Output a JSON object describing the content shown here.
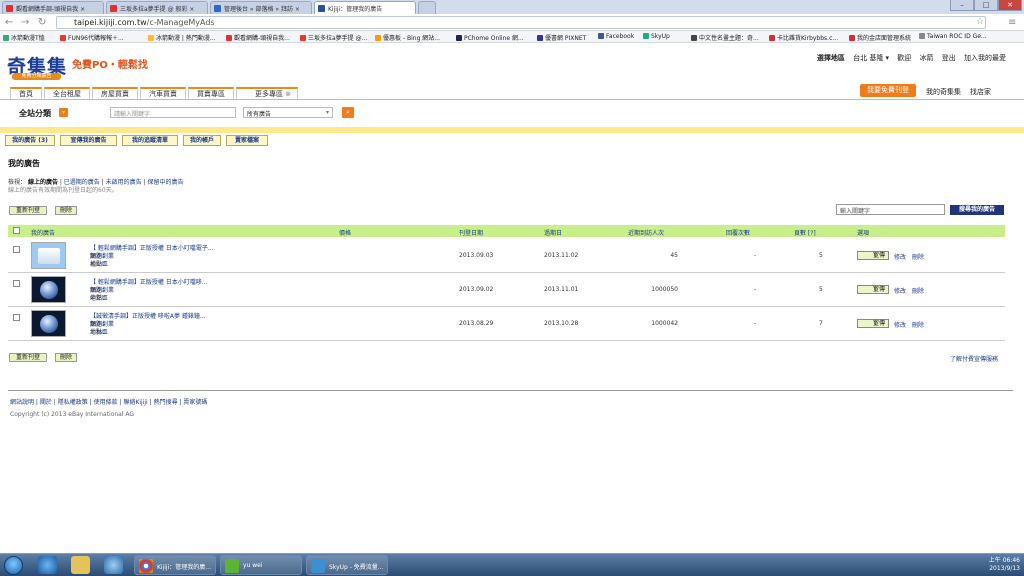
{
  "browser": {
    "tabs": [
      {
        "label": "觀看網購手調-頭視自我 ×"
      },
      {
        "label": "三坂多拉a夢手提 @ 般彩 ×"
      },
      {
        "label": "管理後台 » 部落格 » 拜訪 ×"
      },
      {
        "label": "Kijiji：管理我的廣告"
      }
    ],
    "url_host": "taipei.kijiji.com.tw",
    "url_path": "/c-ManageMyAds",
    "bookmarks": [
      {
        "label": "冰箭動漫T恤",
        "color": "#3a7"
      },
      {
        "label": "FUN96代購報報＋...",
        "color": "#e33"
      },
      {
        "label": "冰箭動漫 | 熱門動漫...",
        "color": "#fb3"
      },
      {
        "label": "觀看網購-頭視自我...",
        "color": "#d33"
      },
      {
        "label": "三坂多拉a夢手提 @...",
        "color": "#e33"
      },
      {
        "label": "優惠板 - Bing 網站...",
        "color": "#f90"
      },
      {
        "label": "PChome Online 網...",
        "color": "#225"
      },
      {
        "label": "優書網 PIXNET",
        "color": "#339"
      },
      {
        "label": "Facebook",
        "color": "#3b5998"
      },
      {
        "label": "SkyUp",
        "color": "#2a8"
      },
      {
        "label": "中文性名畫主題：奇...",
        "color": "#444"
      },
      {
        "label": "卡比雜貨Kirbybbs.c...",
        "color": "#c33"
      },
      {
        "label": "我的金店面管理系統",
        "color": "#c33"
      },
      {
        "label": "Taiwan ROC ID Ge...",
        "color": "#888"
      }
    ]
  },
  "site": {
    "logo": "奇集集",
    "sublogo": "免費分類廣告",
    "slogan": "免費PO・輕鬆找",
    "region_label": "選擇地區",
    "region_value": "台北 基隆 ▾",
    "welcome": "歡迎",
    "username": "冰箭",
    "logout": "登出",
    "join": "加入我的最愛",
    "nav": [
      "首頁",
      "全台租屋",
      "房屋買賣",
      "汽車買賣",
      "買賣專區",
      "更多專區"
    ],
    "post_button": "我要免費刊登",
    "my_kijiji": "我的奇集集",
    "store": "找店家",
    "all_categories": "全站分類",
    "search_placeholder": "請輸入關鍵字",
    "search_scope": "所有廣告",
    "subtabs": [
      "我的廣告 (3)",
      "宣傳我的廣告",
      "我的追蹤清單",
      "我的帳戶",
      "賣家檔案"
    ]
  },
  "myads": {
    "title": "我的廣告",
    "filter_label": "檢視：",
    "filters": [
      "線上的廣告",
      "已過期的廣告",
      "未啟用的廣告",
      "保留中的廣告"
    ],
    "note": "線上的廣告有效期間為刊登日起的60天。",
    "renew": "重新刊登",
    "delete": "刪除",
    "search_placeholder": "輸入關鍵字",
    "search_button": "搜尋我的廣告",
    "headers": [
      "我的廣告",
      "價格",
      "刊登日期",
      "過期日",
      "近期到訪人次",
      "回覆次數",
      "頁數 [?]",
      "選項"
    ],
    "rows": [
      {
        "title": "【 輕鬆網購手調】正版授權 日本小叮噹電子...",
        "category_label": "類別：",
        "category": "網路創業",
        "area_label": "地點：",
        "area": "松山區",
        "price": "",
        "posted": "2013.09.03",
        "expires": "2013.11.02",
        "visits": "45",
        "replies": "-",
        "pages": "5",
        "thumb": "light"
      },
      {
        "title": "【 輕鬆網購手調】正版授權 日本小叮噹哆...",
        "category_label": "類別：",
        "category": "網路創業",
        "area_label": "地點：",
        "area": "中正區",
        "price": "",
        "posted": "2013.09.02",
        "expires": "2013.11.01",
        "visits": "1000050",
        "replies": "-",
        "pages": "5",
        "thumb": "dark"
      },
      {
        "title": "【誠徵清手調】正版授權 哆啦A夢 鍾錶鐘...",
        "category_label": "類別：",
        "category": "網路創業",
        "area_label": "地點：",
        "area": "士林區",
        "price": "",
        "posted": "2013.08.29",
        "expires": "2013.10.28",
        "visits": "1000042",
        "replies": "-",
        "pages": "7",
        "thumb": "dark"
      }
    ],
    "promote": "宣傳",
    "edit": "修改",
    "remove": "刪除",
    "learn_more": "了解付費宣傳服務"
  },
  "footer": {
    "links": [
      "網站說明",
      "關於",
      "隱私權政策",
      "使用條款",
      "聯絡Kijiji",
      "熱門搜尋",
      "賣家號碼"
    ],
    "copyright": "Copyright (c) 2013 eBay International AG"
  },
  "taskbar": {
    "tasks": [
      "Kijiji：管理我的廣...",
      "yu wei",
      "SkyUp - 免費流量..."
    ],
    "time": "上午 06:46",
    "date": "2013/9/13"
  }
}
